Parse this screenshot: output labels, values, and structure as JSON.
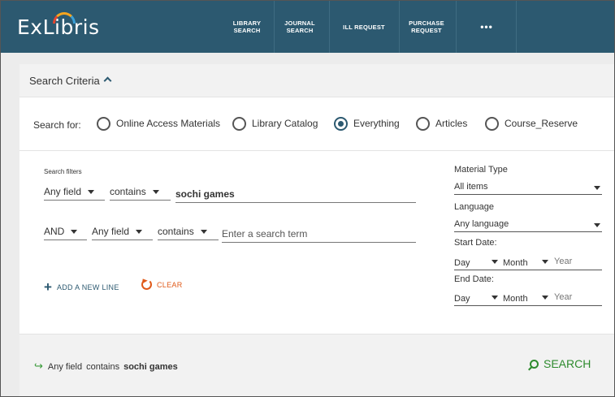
{
  "header": {
    "logo": "ExLibris",
    "nav": [
      {
        "label": "LIBRARY\nSEARCH"
      },
      {
        "label": "JOURNAL\nSEARCH"
      },
      {
        "label": "ILL REQUEST"
      },
      {
        "label": "PURCHASE\nREQUEST"
      },
      {
        "label": "•••"
      }
    ]
  },
  "criteria": {
    "title": "Search Criteria",
    "search_for_label": "Search for:",
    "scopes": [
      {
        "label": "Online Access Materials",
        "selected": false
      },
      {
        "label": "Library Catalog",
        "selected": false
      },
      {
        "label": "Everything",
        "selected": true
      },
      {
        "label": "Articles",
        "selected": false
      },
      {
        "label": "Course_Reserve",
        "selected": false
      }
    ]
  },
  "filters": {
    "label": "Search filters",
    "line1": {
      "field": "Any field",
      "operator": "contains",
      "value": "sochi games"
    },
    "line2": {
      "boolean": "AND",
      "field": "Any field",
      "operator": "contains",
      "placeholder": "Enter a search term"
    },
    "add_line": "ADD A NEW LINE",
    "clear": "CLEAR"
  },
  "facets": {
    "material_type_label": "Material Type",
    "material_type_value": "All items",
    "language_label": "Language",
    "language_value": "Any language",
    "start_date_label": "Start Date:",
    "end_date_label": "End Date:",
    "day": "Day",
    "month": "Month",
    "year": "Year"
  },
  "footer": {
    "summary_field": "Any field",
    "summary_op": "contains",
    "summary_term": "sochi games",
    "search_label": "SEARCH"
  },
  "colors": {
    "nav_bg": "#2c5970",
    "accent": "#2c5970",
    "clear": "#e05a1a",
    "search": "#2e8b2e"
  }
}
